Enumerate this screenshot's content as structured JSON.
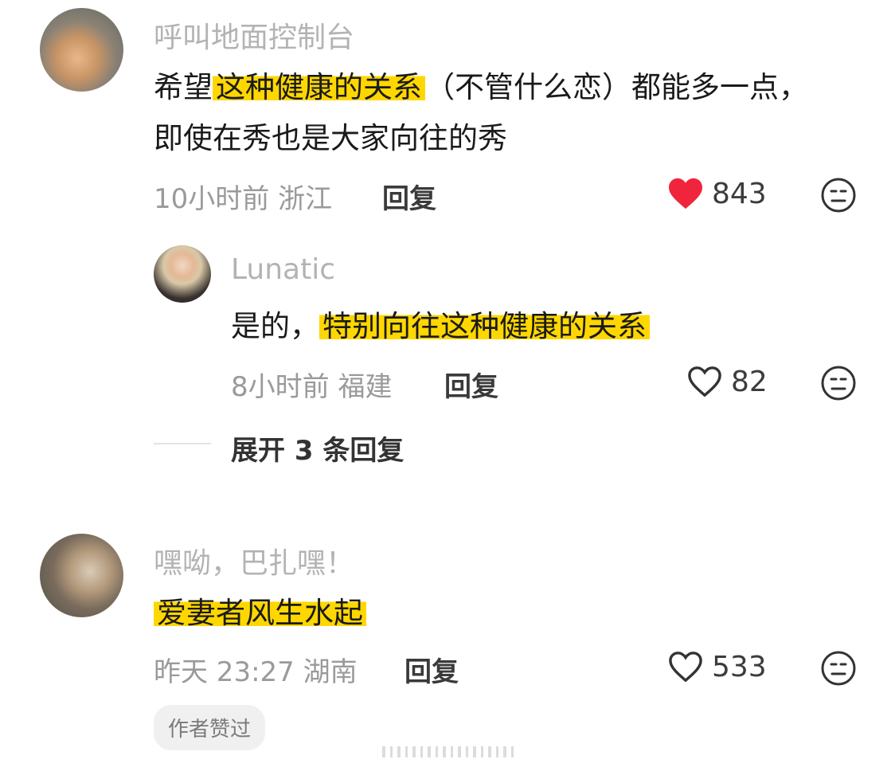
{
  "comments": [
    {
      "name": "呼叫地面控制台",
      "text_before": "希望",
      "text_highlight": "这种健康的关系",
      "text_after": "（不管什么恋）都能多一点，即使在秀也是大家向往的秀",
      "meta": "10小时前 浙江",
      "reply": "回复",
      "likes": "843",
      "liked": true
    },
    {
      "name": "嘿呦，巴扎嘿！",
      "text_highlight": "爱妻者风生水起",
      "meta": "昨天 23:27 湖南",
      "reply": "回复",
      "likes": "533",
      "badge": "作者赞过"
    }
  ],
  "sub_reply": {
    "name": "Lunatic",
    "text_before": "是的，",
    "text_highlight": "特别向往这种健康的关系",
    "meta": "8小时前 福建",
    "reply": "回复",
    "likes": "82"
  },
  "expand": "展开 3 条回复",
  "colors": {
    "highlight": "#ffd700",
    "liked_heart": "#f0253d",
    "meta_gray": "#9a9a9a"
  }
}
